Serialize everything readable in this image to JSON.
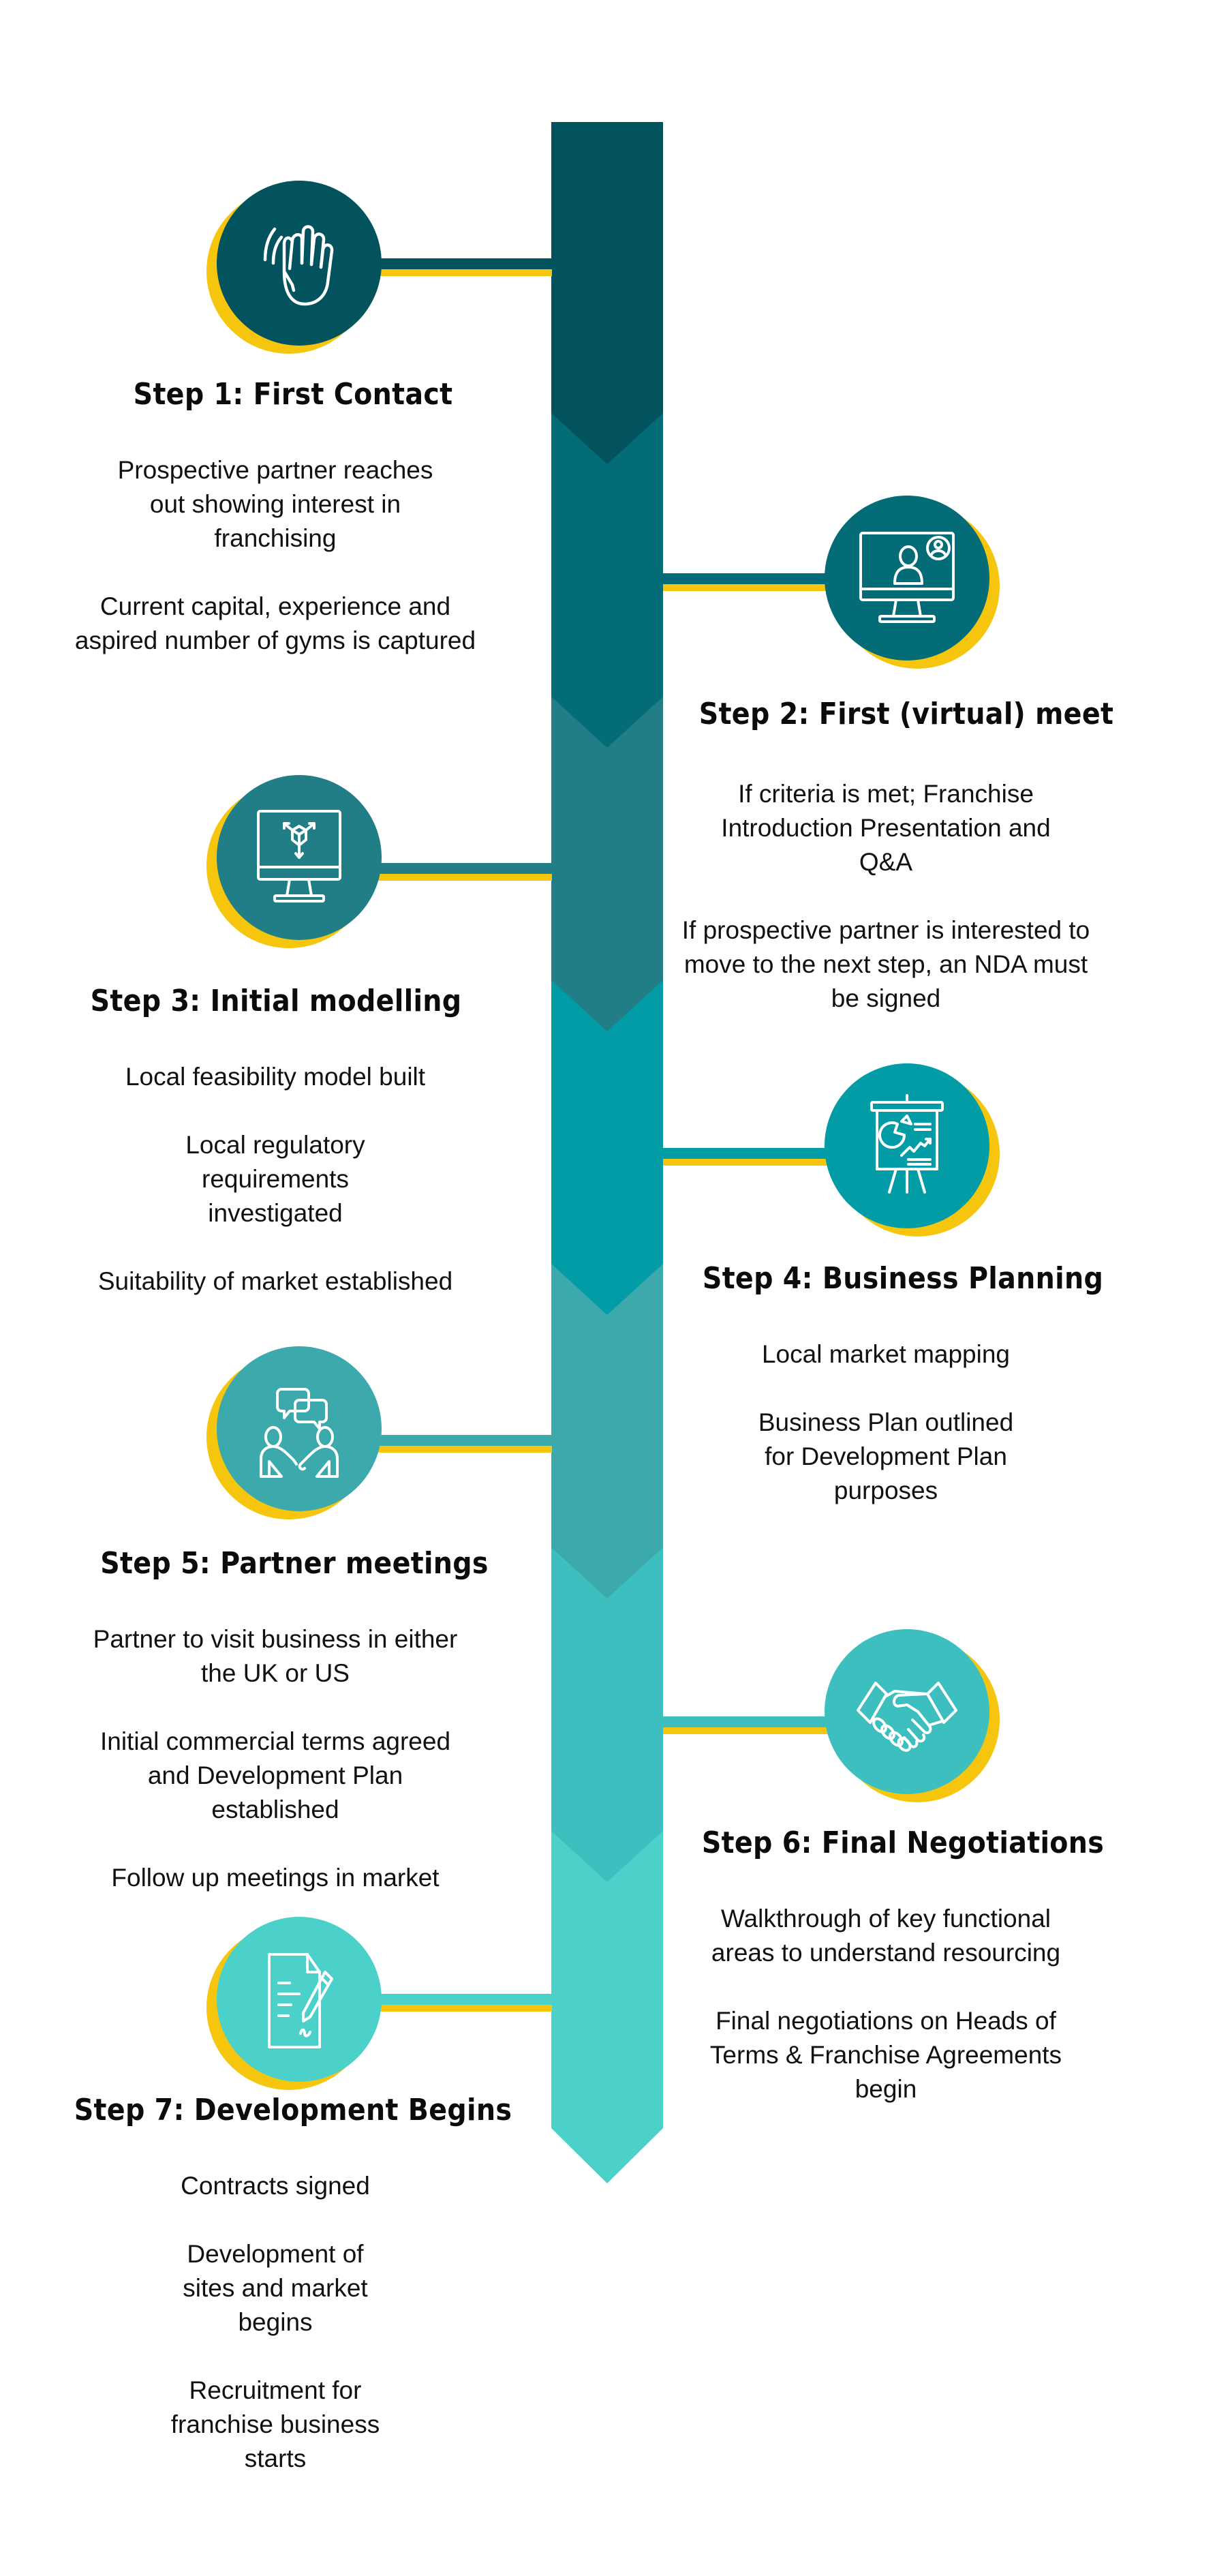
{
  "infographic": {
    "colors": {
      "accent_yellow": "#F6C60F",
      "segments": [
        "#02535E",
        "#046C77",
        "#217E87",
        "#029CA6",
        "#3CA9AC",
        "#3DBFBF",
        "#4BD1C9"
      ]
    },
    "steps": [
      {
        "title": "Step 1: First Contact",
        "icon": "waving-hand-icon",
        "side": "left",
        "points": [
          "Prospective partner reaches out showing interest in franchising",
          "Current capital, experience and aspired number of gyms is captured"
        ]
      },
      {
        "title": "Step 2: First (virtual) meet",
        "icon": "video-call-monitor-icon",
        "side": "right",
        "points": [
          "If criteria is met; Franchise Introduction Presentation and Q&A",
          "If prospective partner is interested to move to the next step, an NDA must be signed"
        ]
      },
      {
        "title": "Step 3: Initial modelling",
        "icon": "monitor-3d-model-icon",
        "side": "left",
        "points": [
          "Local feasibility model built",
          "Local regulatory requirements investigated",
          "Suitability of market established"
        ]
      },
      {
        "title": "Step 4: Business Planning",
        "icon": "presentation-board-icon",
        "side": "right",
        "points": [
          "Local market mapping",
          "Business Plan outlined for Development Plan purposes"
        ]
      },
      {
        "title": "Step 5: Partner meetings",
        "icon": "meeting-people-icon",
        "side": "left",
        "points": [
          "Partner to visit business in either the UK or US",
          "Initial commercial terms agreed and Development Plan established",
          "Follow up meetings in market"
        ]
      },
      {
        "title": "Step 6: Final Negotiations",
        "icon": "handshake-icon",
        "side": "right",
        "points": [
          "Walkthrough of key functional areas to understand resourcing",
          "Final negotiations on Heads of Terms & Franchise Agreements begin"
        ]
      },
      {
        "title": "Step 7: Development Begins",
        "icon": "contract-signing-icon",
        "side": "left",
        "points": [
          "Contracts signed",
          "Development of sites and market begins",
          "Recruitment for franchise business starts"
        ]
      }
    ]
  }
}
